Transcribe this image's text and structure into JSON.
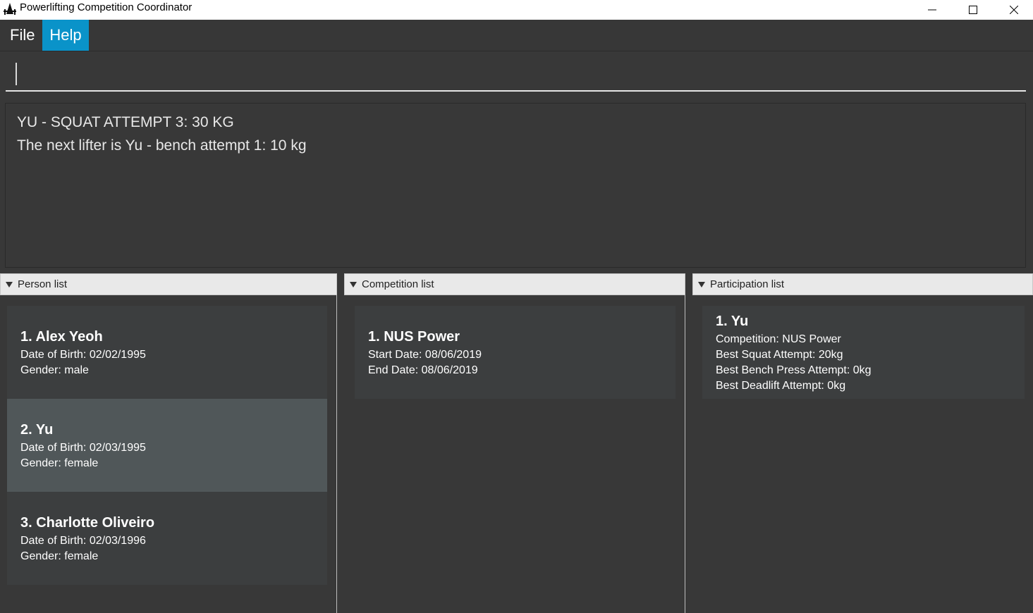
{
  "window": {
    "title": "Powerlifting Competition Coordinator"
  },
  "menu": {
    "file_label": "File",
    "help_label": "Help"
  },
  "command": {
    "value": "",
    "placeholder": ""
  },
  "result": {
    "line1": "YU - SQUAT ATTEMPT 3: 30 KG",
    "line2": "The next lifter is Yu - bench attempt 1: 10 kg"
  },
  "panels": {
    "person": {
      "title": "Person list",
      "items": [
        {
          "name": "1.  Alex Yeoh",
          "dob": "Date of Birth: 02/02/1995",
          "gender": "Gender: male"
        },
        {
          "name": "2.  Yu",
          "dob": "Date of Birth: 02/03/1995",
          "gender": "Gender: female"
        },
        {
          "name": "3.  Charlotte Oliveiro",
          "dob": "Date of Birth: 02/03/1996",
          "gender": "Gender: female"
        }
      ]
    },
    "competition": {
      "title": "Competition list",
      "items": [
        {
          "name": "1.  NUS Power",
          "start": "Start Date: 08/06/2019",
          "end": "End Date: 08/06/2019"
        }
      ]
    },
    "participation": {
      "title": "Participation list",
      "items": [
        {
          "name": "1.  Yu",
          "competition": "Competition: NUS Power",
          "squat": "Best Squat Attempt: 20kg",
          "bench": "Best Bench Press Attempt: 0kg",
          "deadlift": "Best Deadlift Attempt: 0kg"
        }
      ]
    }
  },
  "colors": {
    "background": "#383838",
    "accent": "#0a93c9",
    "card": "#3c3e3f",
    "card_selected": "#505759"
  },
  "icons": {
    "app": "app-icon",
    "minimize": "minimize-icon",
    "maximize": "maximize-icon",
    "close": "close-icon",
    "collapse": "triangle-down-icon"
  }
}
